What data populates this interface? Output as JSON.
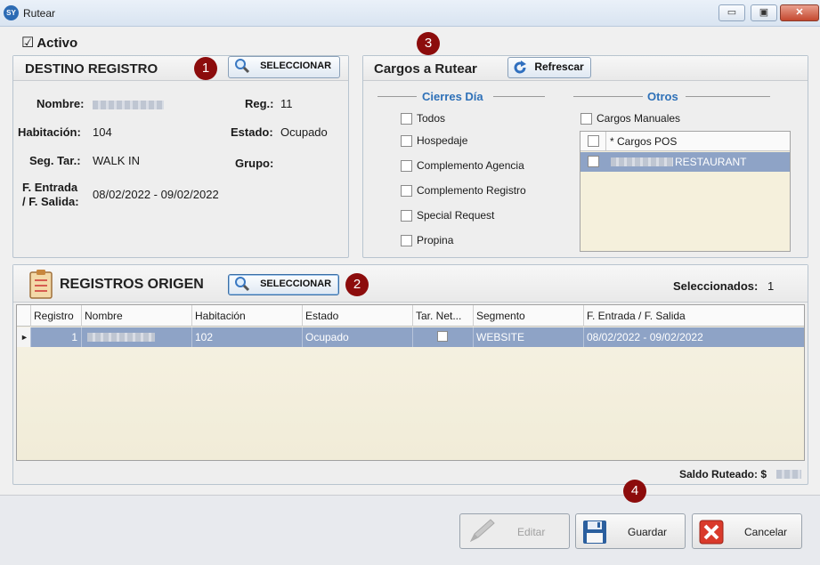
{
  "window": {
    "title": "Rutear",
    "icon_text": "SY",
    "minimize": "▭",
    "restore": "▣",
    "close": "✕"
  },
  "activo": {
    "label": "Activo",
    "checked": true,
    "mark": "☑"
  },
  "destino": {
    "title": "DESTINO REGISTRO",
    "select_button": "SELECCIONAR",
    "badge": "1",
    "nombre_label": "Nombre:",
    "habitacion_label": "Habitación:",
    "habitacion_value": "104",
    "seg_tar_label": "Seg. Tar.:",
    "seg_tar_value": "WALK IN",
    "fechas_label_1": "F. Entrada",
    "fechas_label_2": "/ F. Salida:",
    "fechas_value": "08/02/2022 - 09/02/2022",
    "reg_label": "Reg.:",
    "reg_value": "11",
    "estado_label": "Estado:",
    "estado_value": "Ocupado",
    "grupo_label": "Grupo:"
  },
  "cargos": {
    "title": "Cargos a Rutear",
    "refresh_button": "Refrescar",
    "badge": "3",
    "cierres_header": "Cierres Día",
    "cierres_items": [
      "Todos",
      "Hospedaje",
      "Complemento Agencia",
      "Complemento Registro",
      "Special Request",
      "Propina"
    ],
    "otros_header": "Otros",
    "cargos_manuales": "Cargos Manuales",
    "pos_rows": [
      "* Cargos POS",
      "RESTAURANT"
    ]
  },
  "origen": {
    "title": "REGISTROS ORIGEN",
    "select_button": "SELECCIONAR",
    "badge": "2",
    "seleccionados_label": "Seleccionados:",
    "seleccionados_value": "1",
    "columns": [
      "Registro",
      "Nombre",
      "Habitación",
      "Estado",
      "Tar. Net...",
      "Segmento",
      "F. Entrada / F. Salida"
    ],
    "rows": [
      {
        "registro": "1",
        "habitacion": "102",
        "estado": "Ocupado",
        "segmento": "WEBSITE",
        "fechas": "08/02/2022 - 09/02/2022"
      }
    ],
    "saldo_label": "Saldo Ruteado: $"
  },
  "footer": {
    "badge": "4",
    "editar": "Editar",
    "guardar": "Guardar",
    "cancelar": "Cancelar"
  }
}
